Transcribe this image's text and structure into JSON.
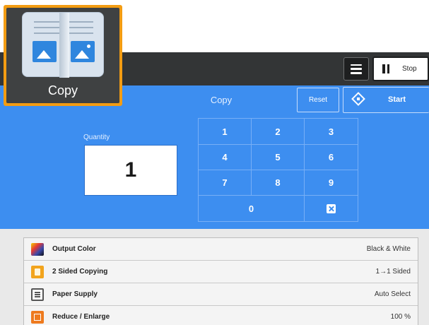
{
  "app_tile": {
    "label": "Copy",
    "icon": "copy-document-icon"
  },
  "toolbar": {
    "menu_icon": "hamburger-menu-icon",
    "stop_label": "Stop",
    "stop_icon": "pause-icon"
  },
  "header": {
    "title": "Copy",
    "reset_label": "Reset",
    "start_label": "Start",
    "start_icon": "start-diamond-icon"
  },
  "quantity": {
    "label": "Quantity",
    "value": "1"
  },
  "keypad": {
    "keys": [
      "1",
      "2",
      "3",
      "4",
      "5",
      "6",
      "7",
      "8",
      "9",
      "0"
    ],
    "clear_icon": "clear-x-icon"
  },
  "settings": [
    {
      "label": "Output Color",
      "value": "Black & White",
      "icon": "output-color-icon"
    },
    {
      "label": "2 Sided Copying",
      "value": "1→1 Sided",
      "icon": "two-sided-icon"
    },
    {
      "label": "Paper Supply",
      "value": "Auto Select",
      "icon": "paper-supply-icon"
    },
    {
      "label": "Reduce / Enlarge",
      "value": "100 %",
      "icon": "reduce-enlarge-icon"
    }
  ],
  "colors": {
    "accent_blue": "#3d8ef0",
    "dark_bar": "#333536",
    "tile_orange": "#f39c12"
  }
}
